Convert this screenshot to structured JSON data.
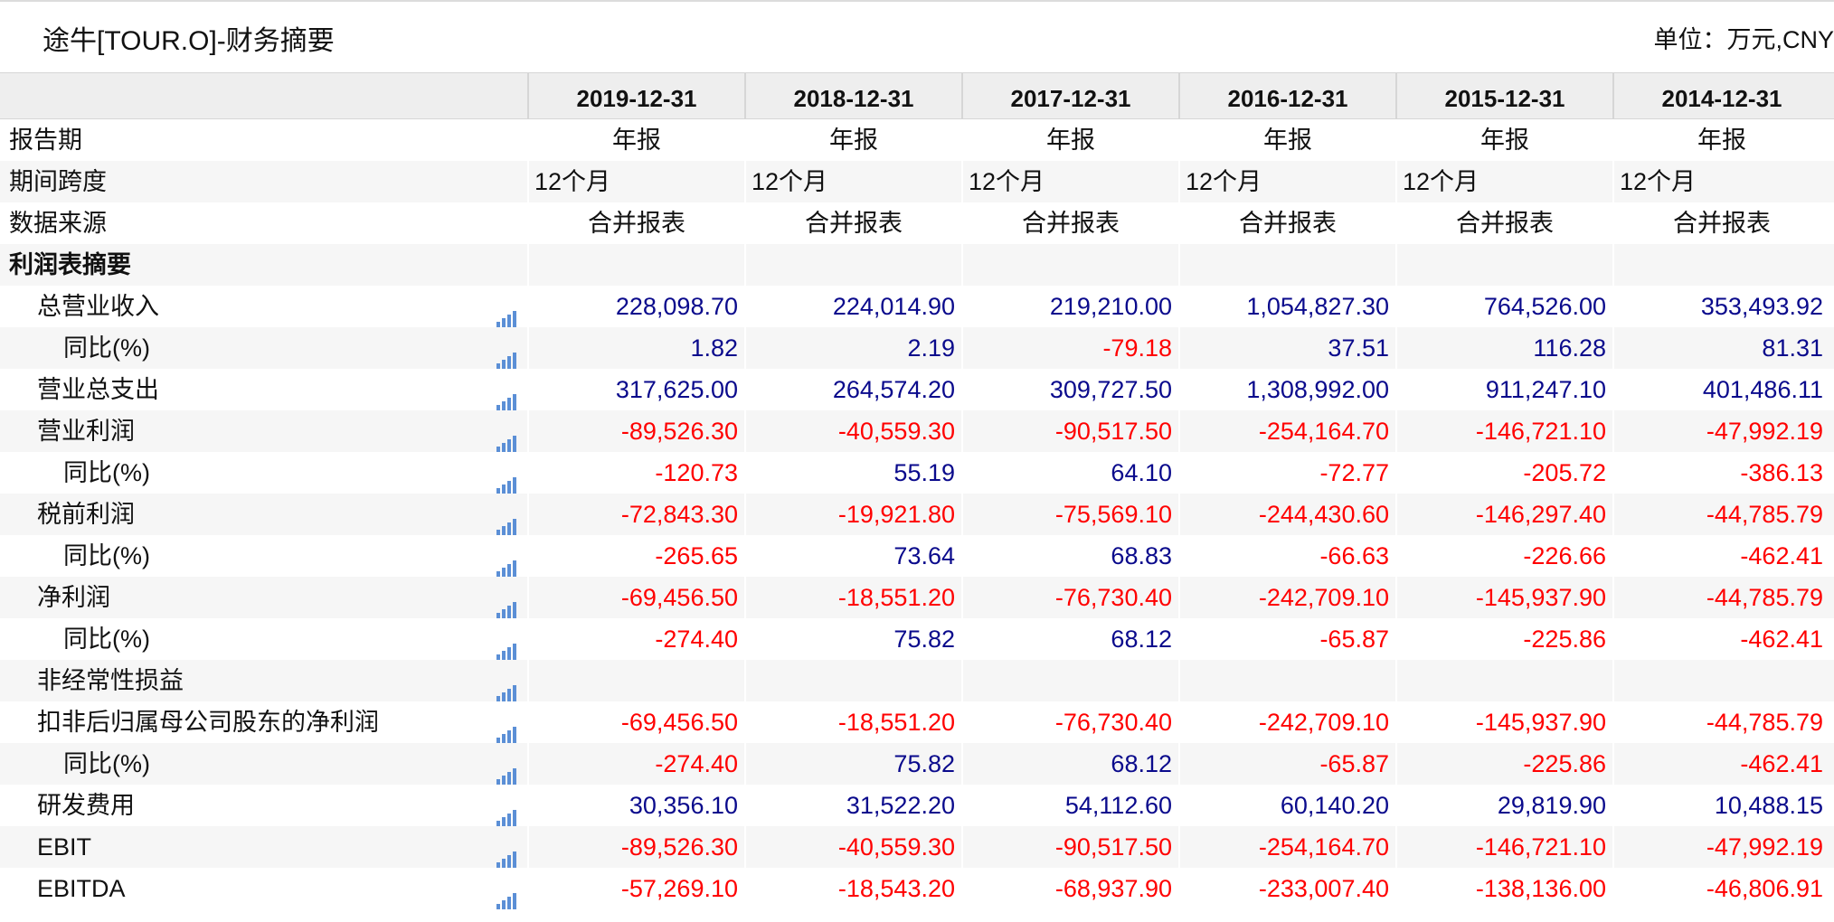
{
  "header": {
    "title": "途牛[TOUR.O]-财务摘要",
    "unit": "单位：万元,CNY"
  },
  "colors": {
    "positive": "#0a0a8c",
    "negative": "#ff0000",
    "icon": "#5b8fd6"
  },
  "columns": [
    "2019-12-31",
    "2018-12-31",
    "2017-12-31",
    "2016-12-31",
    "2015-12-31",
    "2014-12-31"
  ],
  "rows": [
    {
      "label": "报告期",
      "values": [
        "年报",
        "年报",
        "年报",
        "年报",
        "年报",
        "年报"
      ]
    },
    {
      "label": "期间跨度",
      "values": [
        "12个月",
        "12个月",
        "12个月",
        "12个月",
        "12个月",
        "12个月"
      ]
    },
    {
      "label": "数据来源",
      "values": [
        "合并报表",
        "合并报表",
        "合并报表",
        "合并报表",
        "合并报表",
        "合并报表"
      ]
    },
    {
      "label": "利润表摘要",
      "values": [
        "",
        "",
        "",
        "",
        "",
        ""
      ]
    },
    {
      "label": "总营业收入",
      "values": [
        "228,098.70",
        "224,014.90",
        "219,210.00",
        "1,054,827.30",
        "764,526.00",
        "353,493.92"
      ]
    },
    {
      "label": "同比(%)",
      "values": [
        "1.82",
        "2.19",
        "-79.18",
        "37.51",
        "116.28",
        "81.31"
      ]
    },
    {
      "label": "营业总支出",
      "values": [
        "317,625.00",
        "264,574.20",
        "309,727.50",
        "1,308,992.00",
        "911,247.10",
        "401,486.11"
      ]
    },
    {
      "label": "营业利润",
      "values": [
        "-89,526.30",
        "-40,559.30",
        "-90,517.50",
        "-254,164.70",
        "-146,721.10",
        "-47,992.19"
      ]
    },
    {
      "label": "同比(%)",
      "values": [
        "-120.73",
        "55.19",
        "64.10",
        "-72.77",
        "-205.72",
        "-386.13"
      ]
    },
    {
      "label": "税前利润",
      "values": [
        "-72,843.30",
        "-19,921.80",
        "-75,569.10",
        "-244,430.60",
        "-146,297.40",
        "-44,785.79"
      ]
    },
    {
      "label": "同比(%)",
      "values": [
        "-265.65",
        "73.64",
        "68.83",
        "-66.63",
        "-226.66",
        "-462.41"
      ]
    },
    {
      "label": "净利润",
      "values": [
        "-69,456.50",
        "-18,551.20",
        "-76,730.40",
        "-242,709.10",
        "-145,937.90",
        "-44,785.79"
      ]
    },
    {
      "label": "同比(%)",
      "values": [
        "-274.40",
        "75.82",
        "68.12",
        "-65.87",
        "-225.86",
        "-462.41"
      ]
    },
    {
      "label": "非经常性损益",
      "values": [
        "",
        "",
        "",
        "",
        "",
        ""
      ]
    },
    {
      "label": "扣非后归属母公司股东的净利润",
      "values": [
        "-69,456.50",
        "-18,551.20",
        "-76,730.40",
        "-242,709.10",
        "-145,937.90",
        "-44,785.79"
      ]
    },
    {
      "label": "同比(%)",
      "values": [
        "-274.40",
        "75.82",
        "68.12",
        "-65.87",
        "-225.86",
        "-462.41"
      ]
    },
    {
      "label": "研发费用",
      "values": [
        "30,356.10",
        "31,522.20",
        "54,112.60",
        "60,140.20",
        "29,819.90",
        "10,488.15"
      ]
    },
    {
      "label": "EBIT",
      "values": [
        "-89,526.30",
        "-40,559.30",
        "-90,517.50",
        "-254,164.70",
        "-146,721.10",
        "-47,992.19"
      ]
    },
    {
      "label": "EBITDA",
      "values": [
        "-57,269.10",
        "-18,543.20",
        "-68,937.90",
        "-233,007.40",
        "-138,136.00",
        "-46,806.91"
      ]
    }
  ]
}
